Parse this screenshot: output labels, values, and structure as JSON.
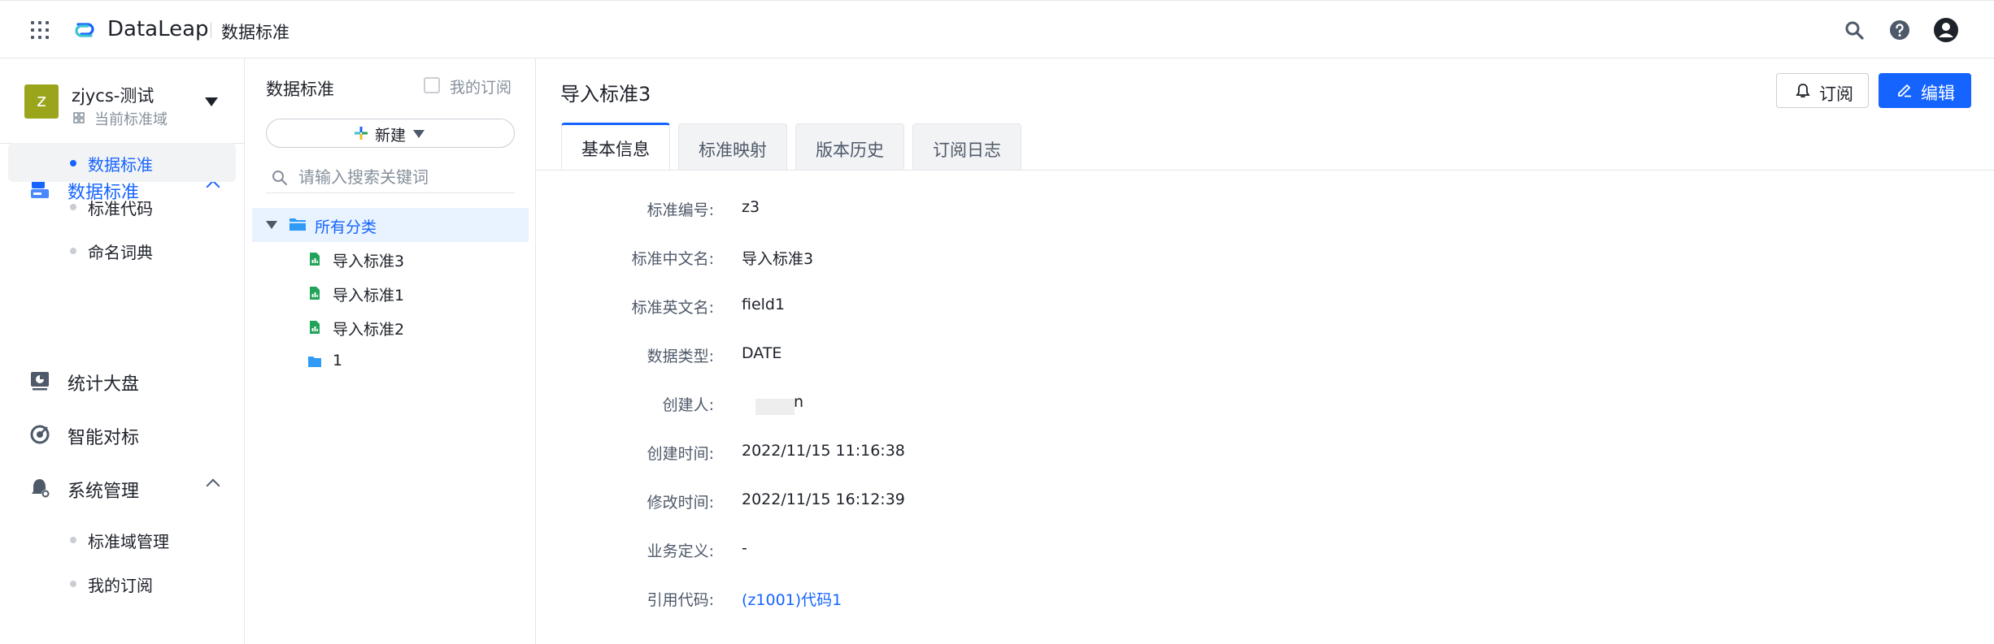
{
  "header": {
    "app_name": "DataLeap",
    "breadcrumb": "数据标准"
  },
  "workspace": {
    "avatar_letter": "z",
    "name": "zjycs-测试",
    "subtitle": "当前标准域"
  },
  "nav": {
    "groups": [
      {
        "label": "数据标准",
        "icon": "data-standard-icon",
        "active": true,
        "expanded": true,
        "children": [
          {
            "label": "数据标准",
            "selected": true
          },
          {
            "label": "标准代码",
            "selected": false
          },
          {
            "label": "命名词典",
            "selected": false
          }
        ]
      },
      {
        "label": "统计大盘",
        "icon": "dashboard-icon"
      },
      {
        "label": "智能对标",
        "icon": "target-icon"
      },
      {
        "label": "系统管理",
        "icon": "admin-icon",
        "expanded": true,
        "children": [
          {
            "label": "标准域管理",
            "selected": false
          },
          {
            "label": "我的订阅",
            "selected": false
          }
        ]
      }
    ]
  },
  "tree_panel": {
    "title": "数据标准",
    "my_subscription_label": "我的订阅",
    "my_subscription_checked": false,
    "new_button_label": "新建",
    "search_placeholder": "请输入搜索关键词",
    "root_label": "所有分类",
    "items": [
      {
        "label": "导入标准3",
        "type": "standard-file"
      },
      {
        "label": "导入标准1",
        "type": "standard-file"
      },
      {
        "label": "导入标准2",
        "type": "standard-file"
      },
      {
        "label": "1",
        "type": "folder"
      }
    ]
  },
  "detail": {
    "title": "导入标准3",
    "subscribe_label": "订阅",
    "edit_label": "编辑",
    "tabs": [
      "基本信息",
      "标准映射",
      "版本历史",
      "订阅日志"
    ],
    "active_tab": 0,
    "fields": [
      {
        "label": "标准编号:",
        "value": "z3"
      },
      {
        "label": "标准中文名:",
        "value": "导入标准3"
      },
      {
        "label": "标准英文名:",
        "value": "field1"
      },
      {
        "label": "数据类型:",
        "value": "DATE"
      },
      {
        "label": "创建人:",
        "value": "n"
      },
      {
        "label": "创建时间:",
        "value": "2022/11/15 11:16:38"
      },
      {
        "label": "修改时间:",
        "value": "2022/11/15 16:12:39"
      },
      {
        "label": "业务定义:",
        "value": "-"
      },
      {
        "label": "引用代码:",
        "value": "(z1001)代码1"
      }
    ]
  },
  "colors": {
    "accent": "#1664ff",
    "avatar": "#9aa51c",
    "selected_bg": "#e8f3ff",
    "file_icon": "#22a35a",
    "folder_icon": "#2f9bf6"
  }
}
